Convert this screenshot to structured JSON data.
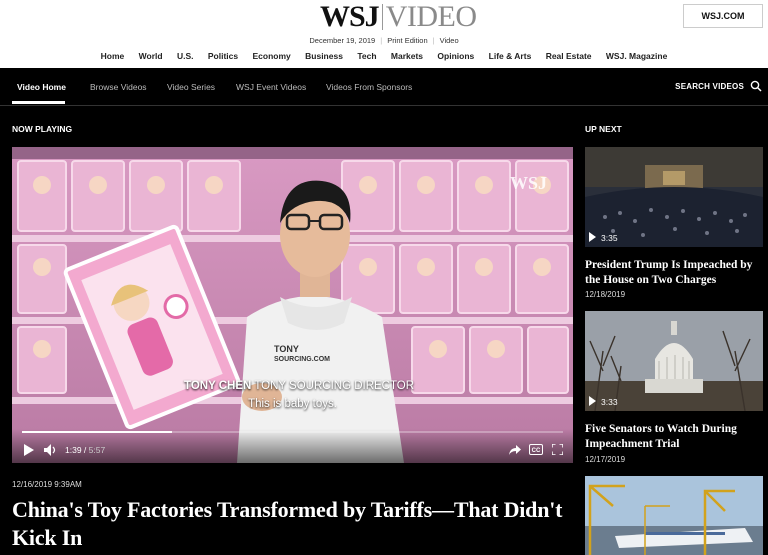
{
  "brand": {
    "logo_left": "WSJ",
    "logo_right": "VIDEO",
    "wsj_link": "WSJ.COM"
  },
  "dateline": {
    "date": "December 19, 2019",
    "print_edition": "Print Edition",
    "video": "Video"
  },
  "main_nav": [
    "Home",
    "World",
    "U.S.",
    "Politics",
    "Economy",
    "Business",
    "Tech",
    "Markets",
    "Opinions",
    "Life & Arts",
    "Real Estate",
    "WSJ. Magazine"
  ],
  "video_nav": {
    "items": [
      "Video Home",
      "Browse Videos",
      "Video Series",
      "WSJ Event Videos",
      "Videos From Sponsors"
    ],
    "active": "Video Home",
    "search_label": "SEARCH VIDEOS"
  },
  "now_playing": {
    "heading": "NOW PLAYING",
    "watermark": "WSJ",
    "caption_name": "TONY CHEN",
    "caption_role": "TONY SOURCING DIRECTOR",
    "caption_text": "This is baby toys.",
    "shirt_logo": "TONY SOURCING.COM",
    "current_time": "1:39",
    "total_time": "5:57",
    "progress": 0.277,
    "date": "12/16/2019 9:39AM",
    "title": "China's Toy Factories Transformed by Tariffs—That Didn't Kick In"
  },
  "up_next": {
    "heading": "UP NEXT",
    "items": [
      {
        "duration": "3:35",
        "title": "President Trump Is Impeached by the House on Two Charges",
        "date": "12/18/2019"
      },
      {
        "duration": "3:33",
        "title": "Five Senators to Watch During Impeachment Trial",
        "date": "12/17/2019"
      },
      {
        "duration": "",
        "title": "",
        "date": ""
      }
    ]
  },
  "colors": {
    "background": "#000000",
    "header_bg": "#ffffff",
    "video_pink": "#c98fb4"
  }
}
